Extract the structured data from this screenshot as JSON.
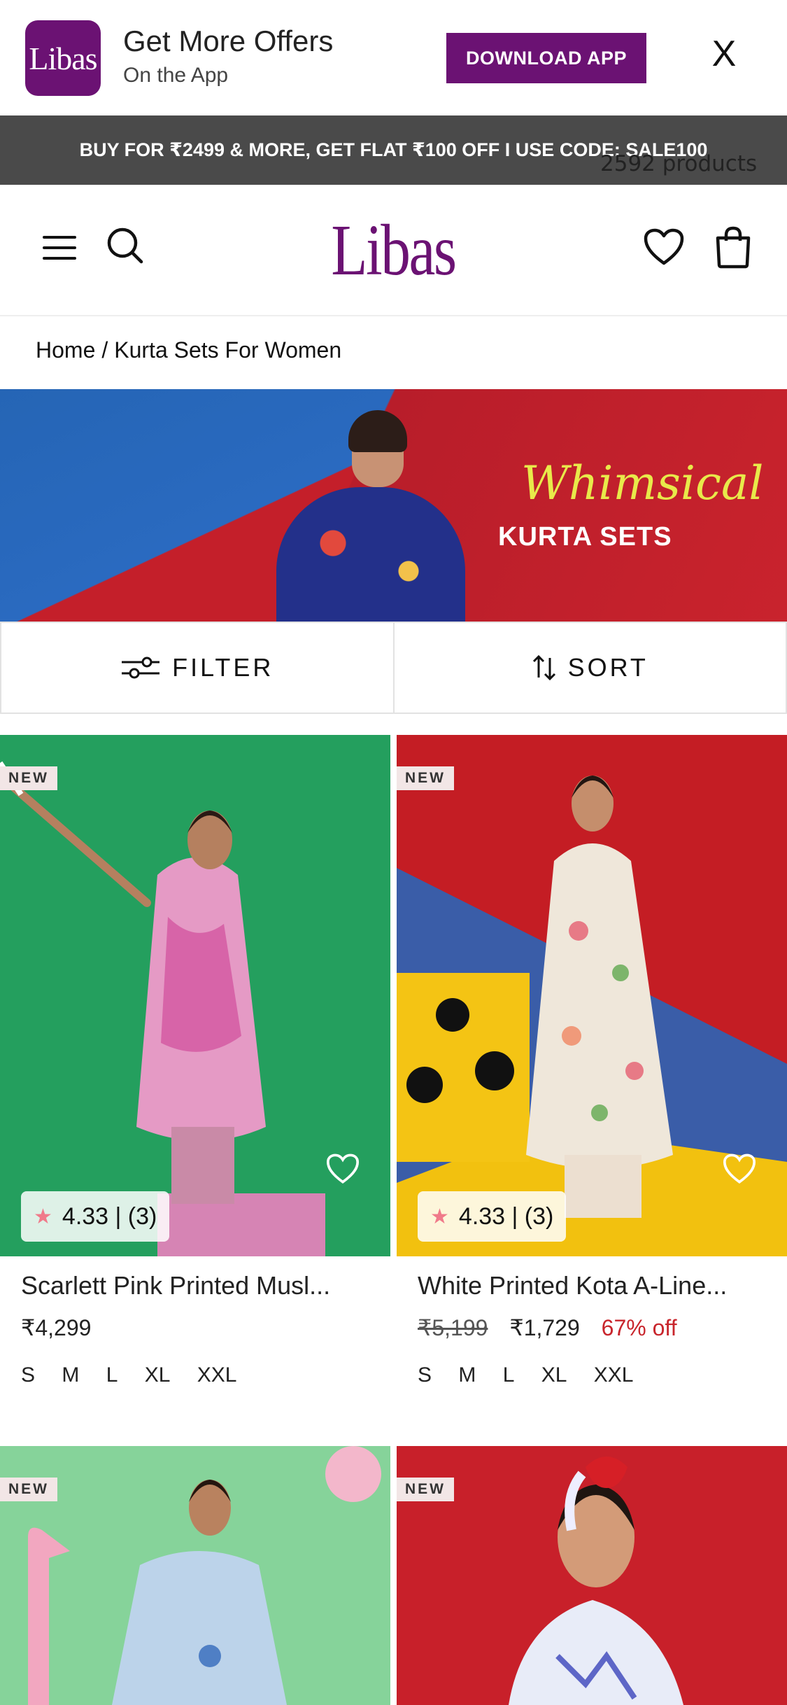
{
  "app_banner": {
    "logo_text": "Libas",
    "title": "Get More Offers",
    "subtitle": "On the App",
    "download_label": "DOWNLOAD APP",
    "close_label": "X"
  },
  "promo": {
    "text": "BUY FOR ₹2499 & MORE, GET FLAT ₹100 OFF I USE CODE: SALE100",
    "product_count": "2592 products"
  },
  "header": {
    "brand": "Libas",
    "menu_icon": "menu-icon",
    "search_icon": "search-icon",
    "wishlist_icon": "heart-icon",
    "bag_icon": "bag-icon"
  },
  "breadcrumb": {
    "home": "Home",
    "separator": "/",
    "current": "Kurta Sets For Women"
  },
  "hero": {
    "script_text": "Whimsical",
    "caps_text": "KURTA SETS"
  },
  "controls": {
    "filter_label": "FILTER",
    "sort_label": "SORT"
  },
  "colors": {
    "brand": "#6b1273",
    "promo_bg": "#4a4a4a",
    "discount": "#c8252c"
  },
  "products": [
    {
      "badge": "NEW",
      "rating": "4.33 | (3)",
      "name": "Scarlett Pink Printed Musl...",
      "price": "₹4,299",
      "mrp": "",
      "discount": "",
      "sizes": [
        "S",
        "M",
        "L",
        "XL",
        "XXL"
      ]
    },
    {
      "badge": "NEW",
      "rating": "4.33 | (3)",
      "name": "White Printed Kota A-Line...",
      "price": "₹1,729",
      "mrp": "₹5,199",
      "discount": "67% off",
      "sizes": [
        "S",
        "M",
        "L",
        "XL",
        "XXL"
      ]
    },
    {
      "badge": "NEW"
    },
    {
      "badge": "NEW"
    }
  ]
}
